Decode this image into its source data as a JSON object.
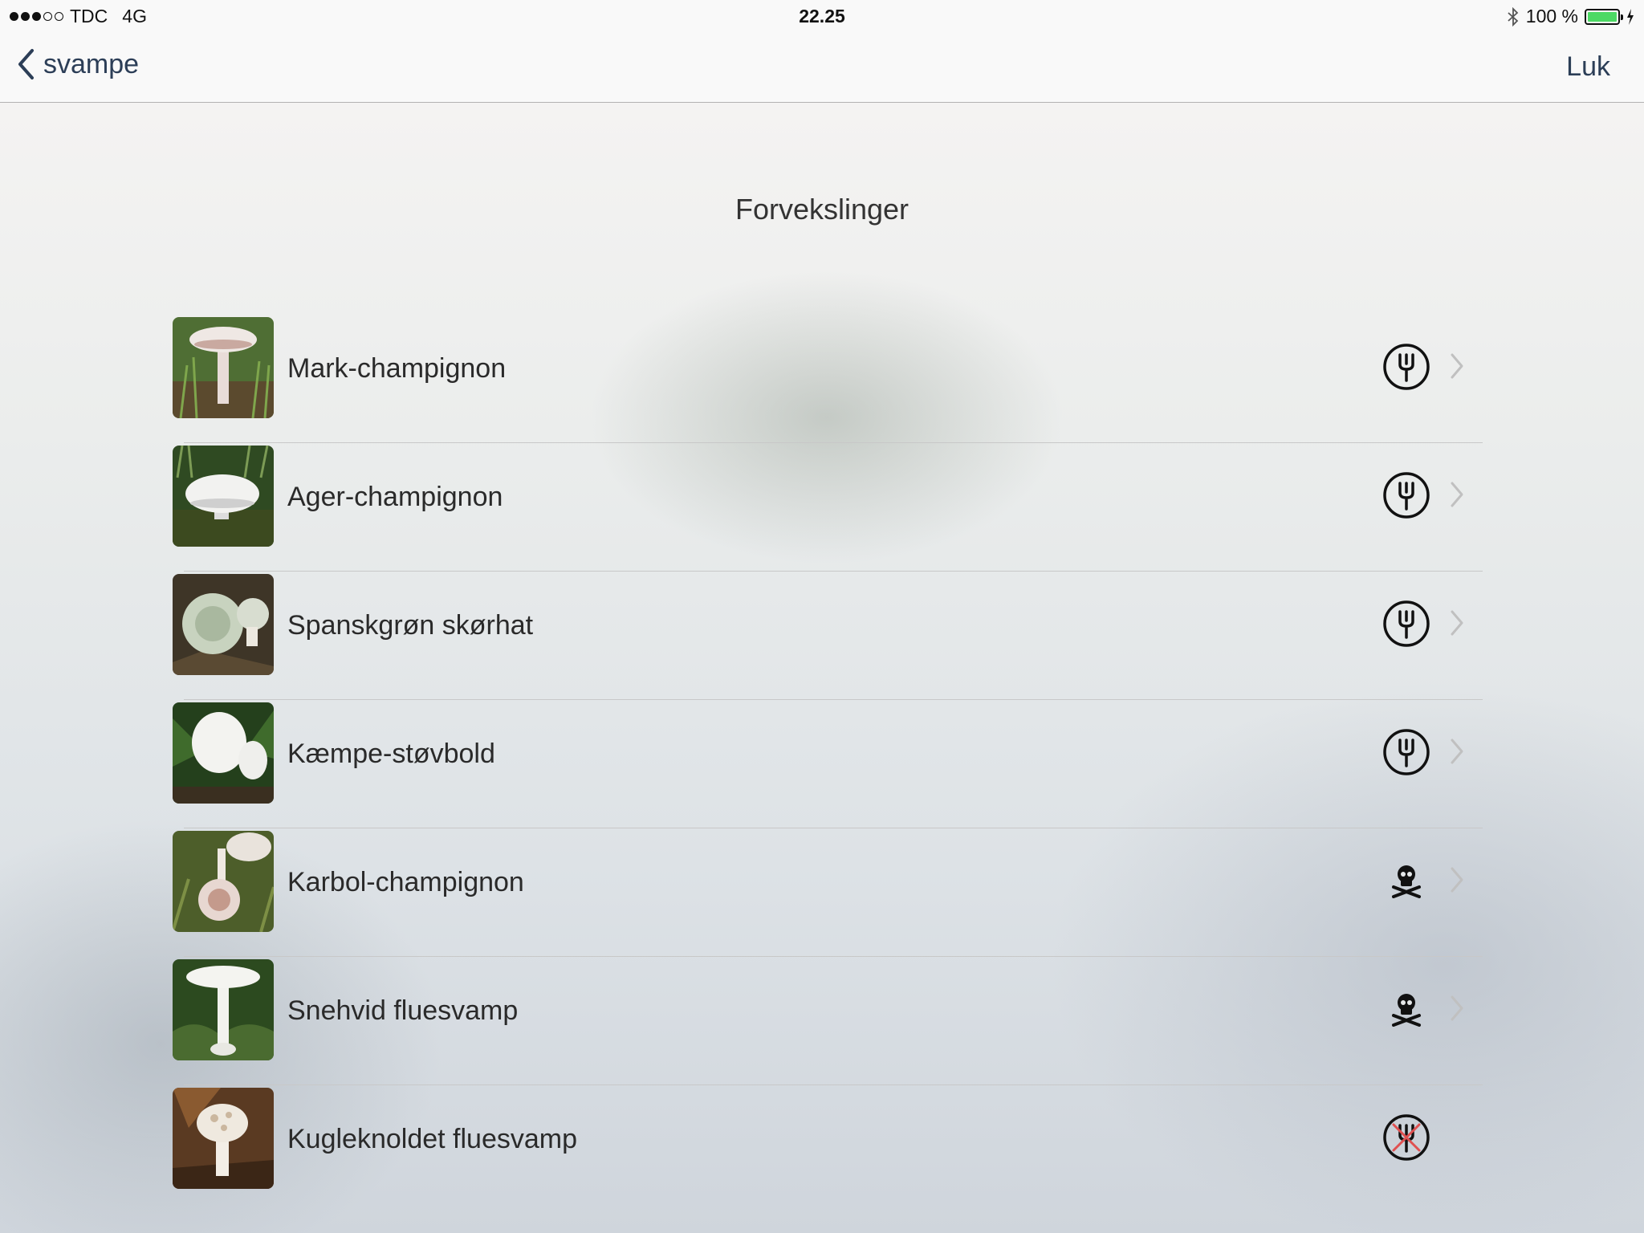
{
  "status_bar": {
    "signal_dots_filled": 3,
    "signal_dots_total": 5,
    "carrier": "TDC",
    "network": "4G",
    "time": "22.25",
    "battery_percent": "100 %"
  },
  "nav": {
    "back_label": "svampe",
    "close_label": "Luk"
  },
  "page": {
    "title": "Forvekslinger"
  },
  "items": [
    {
      "name": "Mark-champignon",
      "status_icon": "fork-icon"
    },
    {
      "name": "Ager-champignon",
      "status_icon": "fork-icon"
    },
    {
      "name": "Spanskgrøn skørhat",
      "status_icon": "fork-icon"
    },
    {
      "name": "Kæmpe-støvbold",
      "status_icon": "fork-icon"
    },
    {
      "name": "Karbol-champignon",
      "status_icon": "skull-crossbones-icon"
    },
    {
      "name": "Snehvid fluesvamp",
      "status_icon": "skull-crossbones-icon"
    },
    {
      "name": "Kugleknoldet fluesvamp",
      "status_icon": "not-edible-icon"
    }
  ],
  "colors": {
    "accent": "#2c3e57",
    "battery": "#4cd964",
    "not_edible_cross": "#e05050"
  }
}
